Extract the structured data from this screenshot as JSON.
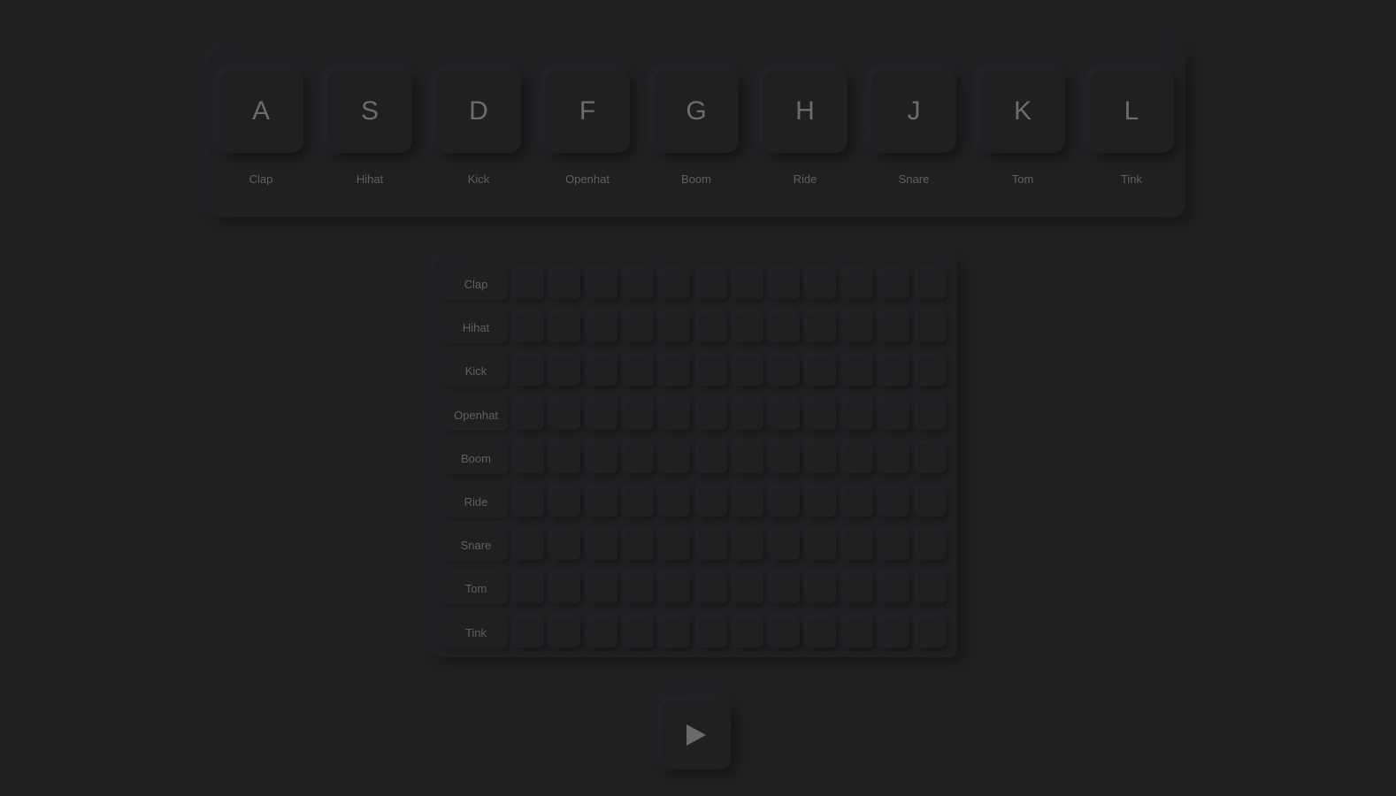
{
  "pads": [
    {
      "key": "A",
      "name": "Clap"
    },
    {
      "key": "S",
      "name": "Hihat"
    },
    {
      "key": "D",
      "name": "Kick"
    },
    {
      "key": "F",
      "name": "Openhat"
    },
    {
      "key": "G",
      "name": "Boom"
    },
    {
      "key": "H",
      "name": "Ride"
    },
    {
      "key": "J",
      "name": "Snare"
    },
    {
      "key": "K",
      "name": "Tom"
    },
    {
      "key": "L",
      "name": "Tink"
    }
  ],
  "sequencer": {
    "rows": [
      "Clap",
      "Hihat",
      "Kick",
      "Openhat",
      "Boom",
      "Ride",
      "Snare",
      "Tom",
      "Tink"
    ],
    "steps": 12,
    "active_steps": []
  },
  "play_button": {
    "icon": "play-icon"
  },
  "colors": {
    "background": "#1f2022",
    "text": "#6b6c6e",
    "label": "#5e5f61"
  }
}
